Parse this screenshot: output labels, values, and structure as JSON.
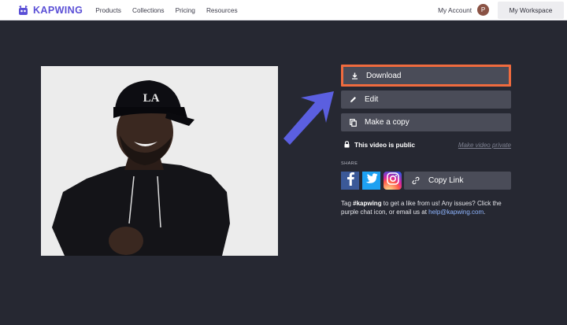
{
  "brand": {
    "name": "KAPWING",
    "color": "#5a4fd6"
  },
  "nav": {
    "links": [
      "Products",
      "Collections",
      "Pricing",
      "Resources"
    ],
    "account_label": "My Account",
    "avatar_initial": "P",
    "workspace_label": "My Workspace"
  },
  "actions": {
    "download_label": "Download",
    "edit_label": "Edit",
    "copy_label": "Make a copy",
    "highlight_color": "#f06b3e"
  },
  "visibility": {
    "status_text": "This video is public",
    "toggle_link": "Make video private"
  },
  "share": {
    "label": "SHARE",
    "copy_link_label": "Copy Link",
    "message": {
      "prefix": "Tag ",
      "hashtag": "#kapwing",
      "middle": " to get a like from us! Any issues? Click the purple chat icon, or email us at ",
      "email": "help@kapwing.com",
      "suffix": "."
    }
  },
  "icons": {
    "download": "download-icon",
    "edit": "pencil-icon",
    "copy": "copy-icon",
    "lock": "lock-icon",
    "link": "link-icon",
    "facebook": "facebook-icon",
    "twitter": "twitter-icon",
    "instagram": "instagram-icon",
    "arrow": "arrow-pointer-icon"
  },
  "colors": {
    "background": "#262832",
    "button": "#4a4c58",
    "arrow": "#5b5fe0"
  }
}
